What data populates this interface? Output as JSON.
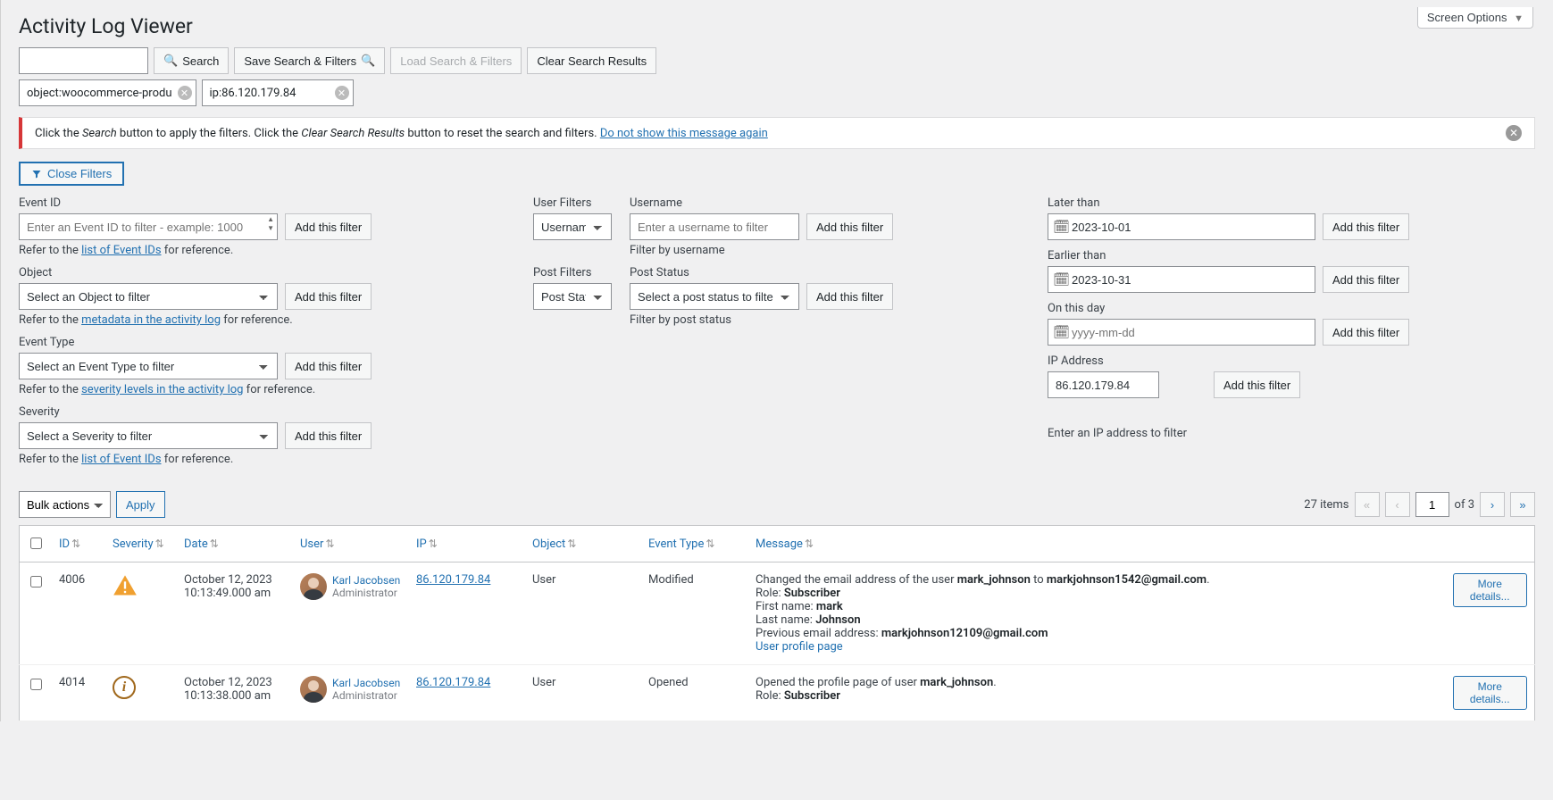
{
  "screen_options": "Screen Options",
  "page_title": "Activity Log Viewer",
  "toolbar": {
    "search": "Search",
    "save_search": "Save Search & Filters",
    "load_search": "Load Search & Filters",
    "clear_search": "Clear Search Results"
  },
  "chips": {
    "object": "object:woocommerce-produ",
    "ip": "ip:86.120.179.84"
  },
  "notice": {
    "pre1": "Click the ",
    "em1": "Search",
    "mid1": " button to apply the filters. Click the ",
    "em2": "Clear Search Results",
    "mid2": " button to reset the search and filters. ",
    "link": "Do not show this message again"
  },
  "close_filters": "Close Filters",
  "col1": {
    "event_id": {
      "label": "Event ID",
      "placeholder": "Enter an Event ID to filter - example: 1000",
      "helper_pre": "Refer to the ",
      "helper_link": "list of Event IDs",
      "helper_post": " for reference."
    },
    "object": {
      "label": "Object",
      "placeholder": "Select an Object to filter",
      "helper_pre": "Refer to the ",
      "helper_link": "metadata in the activity log",
      "helper_post": " for reference."
    },
    "event_type": {
      "label": "Event Type",
      "placeholder": "Select an Event Type to filter",
      "helper_pre": "Refer to the ",
      "helper_link": "severity levels in the activity log",
      "helper_post": " for reference."
    },
    "severity": {
      "label": "Severity",
      "placeholder": "Select a Severity to filter",
      "helper_pre": "Refer to the ",
      "helper_link": "list of Event IDs",
      "helper_post": " for reference."
    }
  },
  "col2": {
    "user_filters_label": "User Filters",
    "username_select": "Username",
    "username": {
      "label": "Username",
      "placeholder": "Enter a username to filter",
      "helper": "Filter by username"
    },
    "post_filters_label": "Post Filters",
    "poststatus_select": "Post Status",
    "poststatus": {
      "label": "Post Status",
      "placeholder": "Select a post status to filter",
      "helper": "Filter by post status"
    }
  },
  "col3": {
    "later": {
      "label": "Later than",
      "value": "2023-10-01"
    },
    "earlier": {
      "label": "Earlier than",
      "value": "2023-10-31"
    },
    "onday": {
      "label": "On this day",
      "placeholder": "yyyy-mm-dd"
    },
    "ip": {
      "label": "IP Address",
      "value": "86.120.179.84",
      "helper": "Enter an IP address to filter"
    }
  },
  "add_filter": "Add this filter",
  "bulk": {
    "label": "Bulk actions",
    "apply": "Apply"
  },
  "pagination": {
    "items": "27 items",
    "current": "1",
    "of": "of 3"
  },
  "columns": {
    "id": "ID",
    "severity": "Severity",
    "date": "Date",
    "user": "User",
    "ip": "IP",
    "object": "Object",
    "event_type": "Event Type",
    "message": "Message"
  },
  "rows": [
    {
      "id": "4006",
      "severity": "warn",
      "date_line1": "October 12, 2023",
      "date_line2": "10:13:49.000 am",
      "user_name": "Karl Jacobsen",
      "user_role": "Administrator",
      "ip": "86.120.179.84",
      "object": "User",
      "event_type": "Modified",
      "msg": {
        "line1_pre": "Changed the email address of the user ",
        "line1_b1": "mark_johnson",
        "line1_mid": " to ",
        "line1_b2": "markjohnson1542@gmail.com",
        "line1_post": ".",
        "role_label": "Role: ",
        "role_val": "Subscriber",
        "fn_label": "First name: ",
        "fn_val": "mark",
        "ln_label": "Last name: ",
        "ln_val": "Johnson",
        "prev_label": "Previous email address: ",
        "prev_val": "markjohnson12109@gmail.com",
        "link": "User profile page"
      },
      "more": "More details..."
    },
    {
      "id": "4014",
      "severity": "info",
      "date_line1": "October 12, 2023",
      "date_line2": "10:13:38.000 am",
      "user_name": "Karl Jacobsen",
      "user_role": "Administrator",
      "ip": "86.120.179.84",
      "object": "User",
      "event_type": "Opened",
      "msg": {
        "line1_pre": "Opened the profile page of user ",
        "line1_b1": "mark_johnson",
        "line1_mid": "",
        "line1_b2": "",
        "line1_post": ".",
        "role_label": "Role: ",
        "role_val": "Subscriber",
        "fn_label": "",
        "fn_val": "",
        "ln_label": "",
        "ln_val": "",
        "prev_label": "",
        "prev_val": "",
        "link": ""
      },
      "more": "More details..."
    }
  ]
}
